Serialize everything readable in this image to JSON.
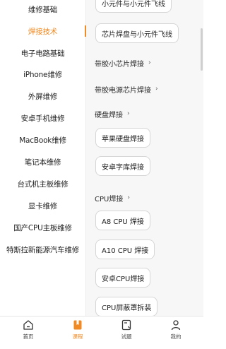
{
  "sidebar": {
    "items": [
      {
        "label": "维修基础"
      },
      {
        "label": "焊接技术",
        "active": true
      },
      {
        "label": "电子电路基础"
      },
      {
        "label": "iPhone维修"
      },
      {
        "label": "外屏维修"
      },
      {
        "label": "安卓手机维修"
      },
      {
        "label": "MacBook维修"
      },
      {
        "label": "笔记本维修"
      },
      {
        "label": "台式机主板维修"
      },
      {
        "label": "显卡维修"
      },
      {
        "label": "国产CPU主板维修"
      },
      {
        "label": "特斯拉新能源汽车维修"
      }
    ]
  },
  "content": {
    "top_pills": [
      "小元件与小元件飞线",
      "芯片焊盘与小元件飞线"
    ],
    "sections": [
      {
        "title": "带胶小芯片焊接",
        "items": []
      },
      {
        "title": "带胶电源芯片焊接",
        "items": []
      },
      {
        "title": "硬盘焊接",
        "items": [
          "苹果硬盘焊接",
          "安卓字库焊接"
        ]
      },
      {
        "title": "CPU焊接",
        "items": [
          "A8 CPU 焊接",
          "A10 CPU 焊接",
          "安卓CPU焊接",
          "CPU屏蔽罩拆装"
        ]
      }
    ],
    "chevron": "›"
  },
  "tabbar": {
    "tabs": [
      {
        "label": "首页",
        "icon": "home-icon"
      },
      {
        "label": "课程",
        "icon": "bookmark-icon",
        "active": true
      },
      {
        "label": "试题",
        "icon": "exam-icon"
      },
      {
        "label": "我的",
        "icon": "profile-icon"
      }
    ],
    "accent": "#f08a24"
  }
}
